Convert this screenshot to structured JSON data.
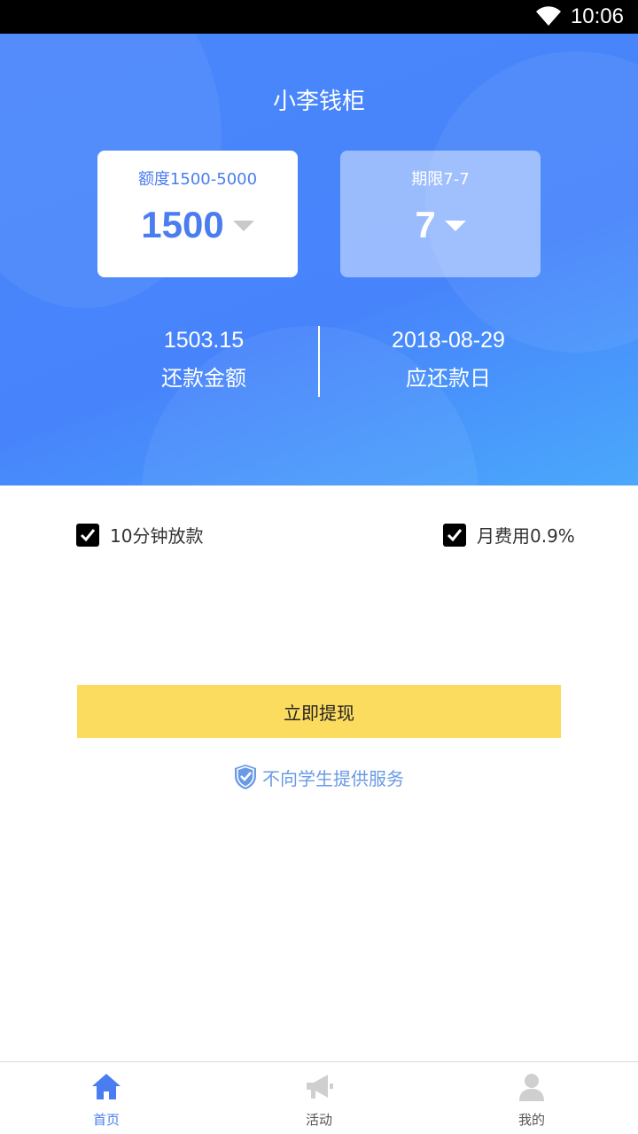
{
  "status_bar": {
    "time": "10:06"
  },
  "header": {
    "title": "小李钱柜"
  },
  "amount_card": {
    "label": "额度1500-5000",
    "value": "1500"
  },
  "term_card": {
    "label": "期限7-7",
    "value": "7"
  },
  "summary": {
    "repay_amount": {
      "value": "1503.15",
      "label": "还款金额"
    },
    "due_date": {
      "value": "2018-08-29",
      "label": "应还款日"
    }
  },
  "options": [
    {
      "label": "10分钟放款",
      "checked": true
    },
    {
      "label": "月费用0.9%",
      "checked": true
    }
  ],
  "submit": {
    "label": "立即提现"
  },
  "notice": {
    "text": "不向学生提供服务"
  },
  "tabbar": {
    "items": [
      {
        "label": "首页",
        "icon": "home-icon",
        "active": true
      },
      {
        "label": "活动",
        "icon": "megaphone-icon",
        "active": false
      },
      {
        "label": "我的",
        "icon": "user-icon",
        "active": false
      }
    ]
  },
  "colors": {
    "primary": "#4a7df0",
    "button_yellow": "#fcdc5e",
    "hero_blue": "#4784fb"
  }
}
